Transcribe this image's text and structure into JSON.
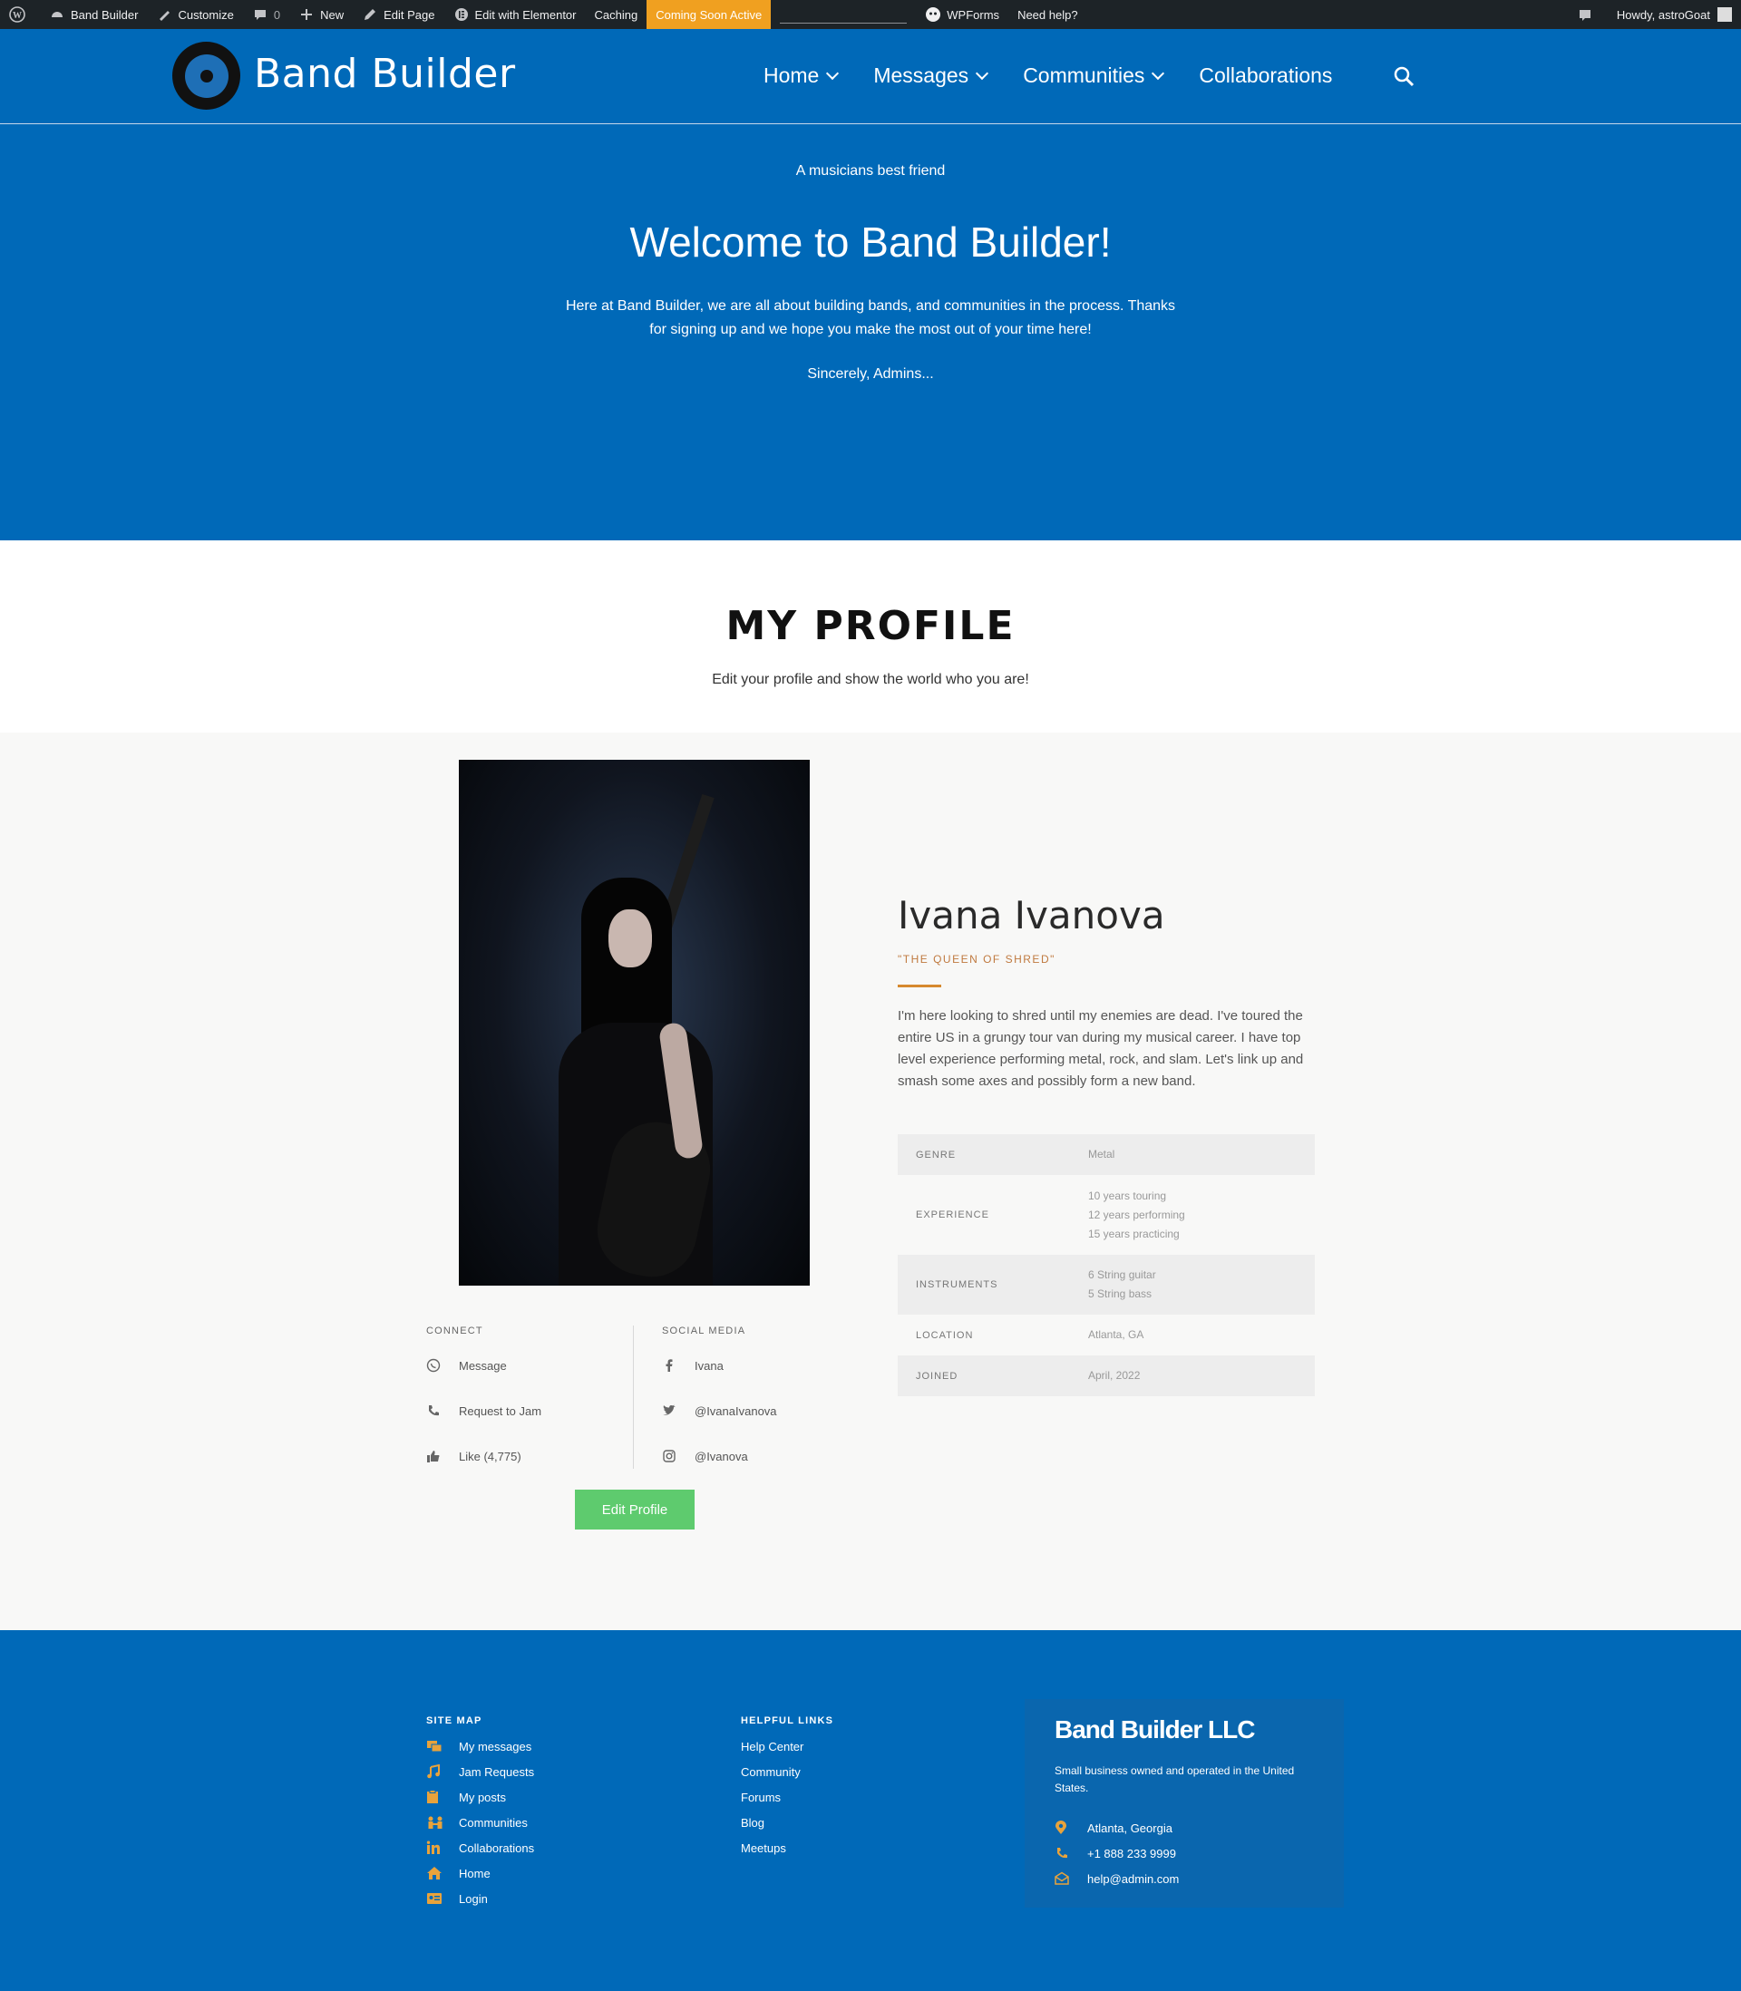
{
  "adminbar": {
    "site": "Band Builder",
    "customize": "Customize",
    "comments_count": "0",
    "new": "New",
    "edit_page": "Edit Page",
    "edit_elementor": "Edit with Elementor",
    "caching": "Caching",
    "coming_soon": "Coming Soon Active",
    "wpforms": "WPForms",
    "need_help": "Need help?",
    "howdy": "Howdy, astroGoat",
    "coming_soon_color": "#f0a020"
  },
  "header": {
    "title": "Band Builder",
    "nav": [
      {
        "label": "Home"
      },
      {
        "label": "Messages"
      },
      {
        "label": "Communities"
      },
      {
        "label": "Collaborations"
      }
    ],
    "brand_color": "#0069b8"
  },
  "hero": {
    "tagline": "A musicians best friend",
    "heading": "Welcome to Band Builder!",
    "text": "Here at Band Builder, we are all about building bands, and communities in the process. Thanks for signing up and we hope you make the most out of your time here!",
    "signoff": "Sincerely, Admins..."
  },
  "profile": {
    "heading": "MY PROFILE",
    "subheading": "Edit your profile and show the world who you are!",
    "name": "Ivana Ivanova",
    "nickname": "\"THE QUEEN OF SHRED\"",
    "bio": "I'm here looking to shred until my enemies are dead. I've toured the entire US in a grungy tour van during my musical career. I have top level experience performing metal, rock, and slam. Let's link up and smash some axes and possibly form a new band.",
    "info": {
      "genre_label": "GENRE",
      "genre": "Metal",
      "experience_label": "EXPERIENCE",
      "experience": [
        "10 years touring",
        "12 years performing",
        "15 years practicing"
      ],
      "instruments_label": "INSTRUMENTS",
      "instruments": [
        "6 String guitar",
        "5 String bass"
      ],
      "location_label": "LOCATION",
      "location": "Atlanta, GA",
      "joined_label": "JOINED",
      "joined": "April, 2022"
    },
    "connect": {
      "heading": "CONNECT",
      "items": [
        {
          "label": "Message",
          "icon": "whatsapp-icon"
        },
        {
          "label": "Request to Jam",
          "icon": "phone-icon"
        },
        {
          "label": "Like (4,775)",
          "icon": "thumbs-up-icon"
        }
      ]
    },
    "social": {
      "heading": "SOCIAL MEDIA",
      "items": [
        {
          "label": "Ivana",
          "icon": "facebook-icon"
        },
        {
          "label": "@IvanaIvanova",
          "icon": "twitter-icon"
        },
        {
          "label": "@Ivanova",
          "icon": "instagram-icon"
        }
      ]
    },
    "edit_button": "Edit Profile",
    "accent_color": "#d6892e",
    "button_color": "#5ecb6e"
  },
  "footer": {
    "sitemap_heading": "SITE MAP",
    "sitemap": [
      {
        "label": "My messages",
        "icon": "messages-icon"
      },
      {
        "label": "Jam Requests",
        "icon": "music-icon"
      },
      {
        "label": "My posts",
        "icon": "clipboard-icon"
      },
      {
        "label": "Communities",
        "icon": "people-icon"
      },
      {
        "label": "Collaborations",
        "icon": "linkedin-icon"
      },
      {
        "label": "Home",
        "icon": "home-icon"
      },
      {
        "label": "Login",
        "icon": "id-card-icon"
      }
    ],
    "helpful_heading": "HELPFUL LINKS",
    "helpful": [
      {
        "label": "Help Center"
      },
      {
        "label": "Community"
      },
      {
        "label": "Forums"
      },
      {
        "label": "Blog"
      },
      {
        "label": "Meetups"
      }
    ],
    "company": {
      "name": "Band Builder LLC",
      "description": "Small business owned and operated in the United States.",
      "location": "Atlanta, Georgia",
      "phone": "+1 888 233 9999",
      "email": "help@admin.com"
    },
    "icon_color": "#e8a33c"
  }
}
